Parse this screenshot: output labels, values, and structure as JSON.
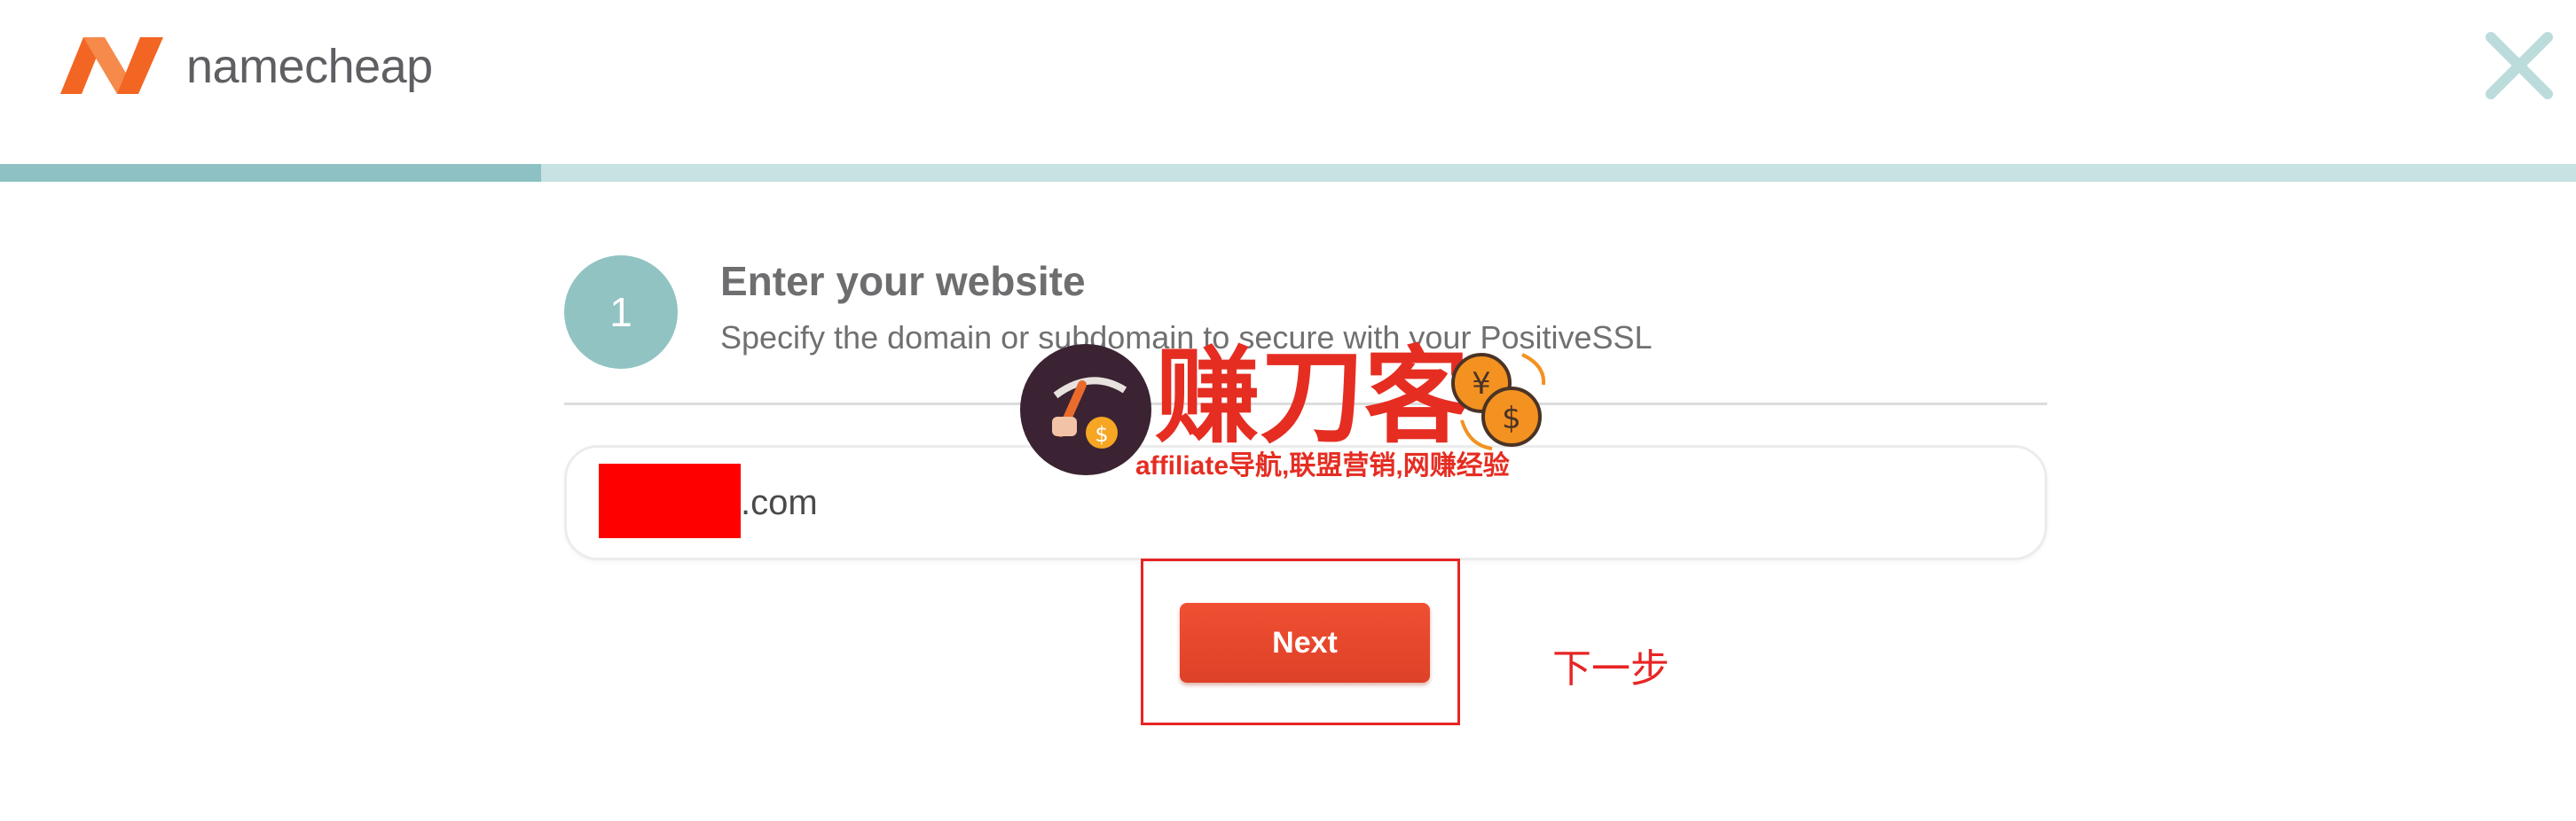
{
  "header": {
    "brand_name": "namecheap",
    "logo_icon": "namecheap-n-logo-icon",
    "close_icon": "close-icon",
    "brand_colors": {
      "orange": "#f26522",
      "close": "#bcdcdc"
    }
  },
  "progress": {
    "fraction": 0.21,
    "fill_color": "#8dc1c3",
    "track_color": "#c6e2e2"
  },
  "step": {
    "number": "1",
    "title": "Enter your website",
    "subtitle": "Specify the domain or subdomain to secure with your PositiveSSL"
  },
  "domain_input": {
    "value": ".com"
  },
  "actions": {
    "next_label": "Next"
  },
  "annotation": {
    "label": "下一步",
    "color": "#e82424"
  },
  "watermark": {
    "title": "赚刀客",
    "subtitle": "affiliate导航,联盟营销,网赚经验",
    "icons": [
      "pickaxe-coin-icon",
      "yen-coin-icon",
      "dollar-coin-icon"
    ]
  }
}
